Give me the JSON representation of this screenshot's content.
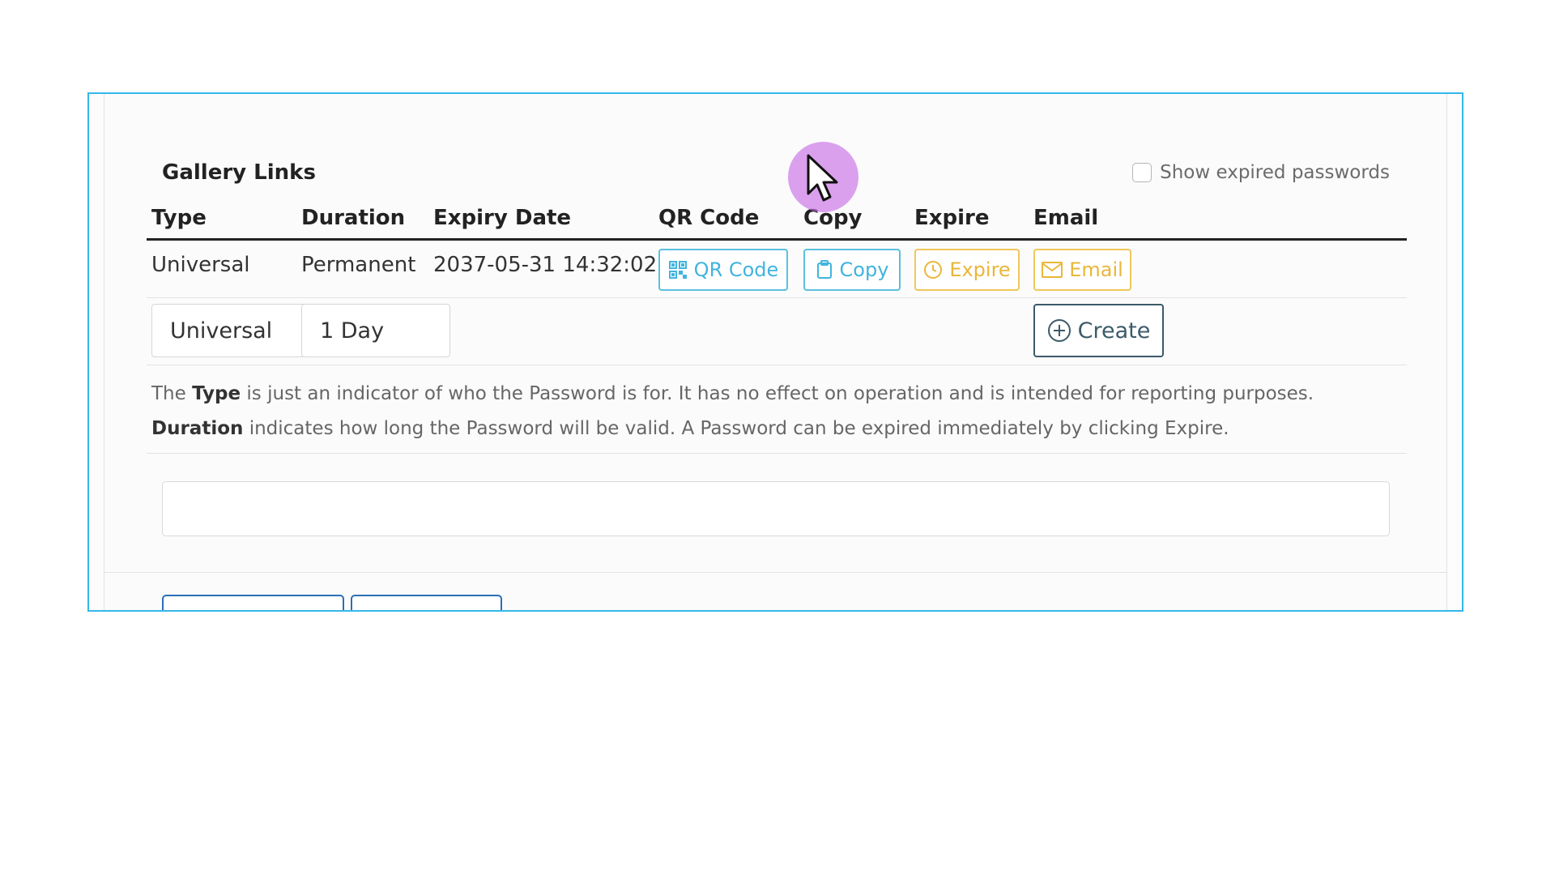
{
  "gallery_links": {
    "title": "Gallery Links",
    "show_expired_label": "Show expired passwords",
    "show_expired_checked": false,
    "columns": [
      "Type",
      "Duration",
      "Expiry Date",
      "QR Code",
      "Copy",
      "Expire",
      "Email"
    ],
    "rows": [
      {
        "type": "Universal",
        "duration": "Permanent",
        "expiry_date": "2037-05-31 14:32:02",
        "qr_button": "QR Code",
        "copy_button": "Copy",
        "expire_button": "Expire",
        "email_button": "Email"
      }
    ],
    "new_row": {
      "type_value": "Universal",
      "duration_value": "1 Day",
      "create_button": "Create"
    },
    "notes": {
      "line1_prefix": "The ",
      "line1_bold": "Type",
      "line1_rest": " is just an indicator of who the Password is for. It has no effect on operation and is intended for reporting purposes.",
      "line2_bold": "Duration",
      "line2_rest": " indicates how long the Password will be valid. A Password can be expired immediately by clicking Expire."
    }
  },
  "colors": {
    "frame_border": "#35b8e8",
    "info": "#41b4de",
    "warning": "#e9b73a",
    "dark": "#3c5a6a",
    "cursor_halo": "#c86ee6"
  },
  "icons": {
    "qr": "qr-code-icon",
    "copy": "clipboard-icon",
    "expire": "clock-icon",
    "email": "envelope-icon",
    "create": "plus-circle-icon",
    "cursor": "mouse-pointer-icon"
  }
}
